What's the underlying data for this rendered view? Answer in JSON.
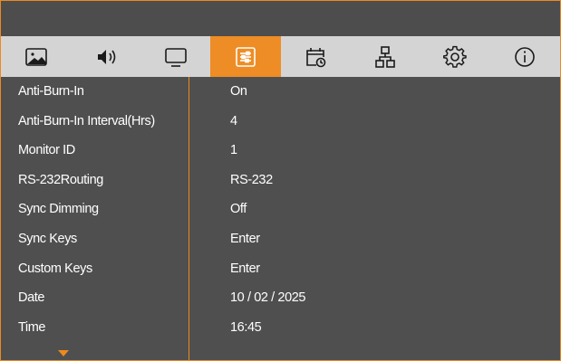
{
  "tabs": [
    {
      "icon": "picture-icon"
    },
    {
      "icon": "sound-icon"
    },
    {
      "icon": "display-icon"
    },
    {
      "icon": "settings-sliders-icon"
    },
    {
      "icon": "schedule-icon"
    },
    {
      "icon": "network-icon"
    },
    {
      "icon": "gear-icon"
    },
    {
      "icon": "info-icon"
    }
  ],
  "active_tab_index": 3,
  "accent_color": "#ec8a1e",
  "settings": [
    {
      "label": "Anti-Burn-In",
      "value": "On"
    },
    {
      "label": "Anti-Burn-In Interval(Hrs)",
      "value": "4"
    },
    {
      "label": "Monitor ID",
      "value": "1"
    },
    {
      "label": "RS-232Routing",
      "value": "RS-232"
    },
    {
      "label": "Sync Dimming",
      "value": "Off"
    },
    {
      "label": "Sync Keys",
      "value": "Enter"
    },
    {
      "label": "Custom Keys",
      "value": "Enter"
    },
    {
      "label": "Date",
      "value": "10 / 02 / 2025"
    },
    {
      "label": "Time",
      "value": "16:45"
    }
  ]
}
